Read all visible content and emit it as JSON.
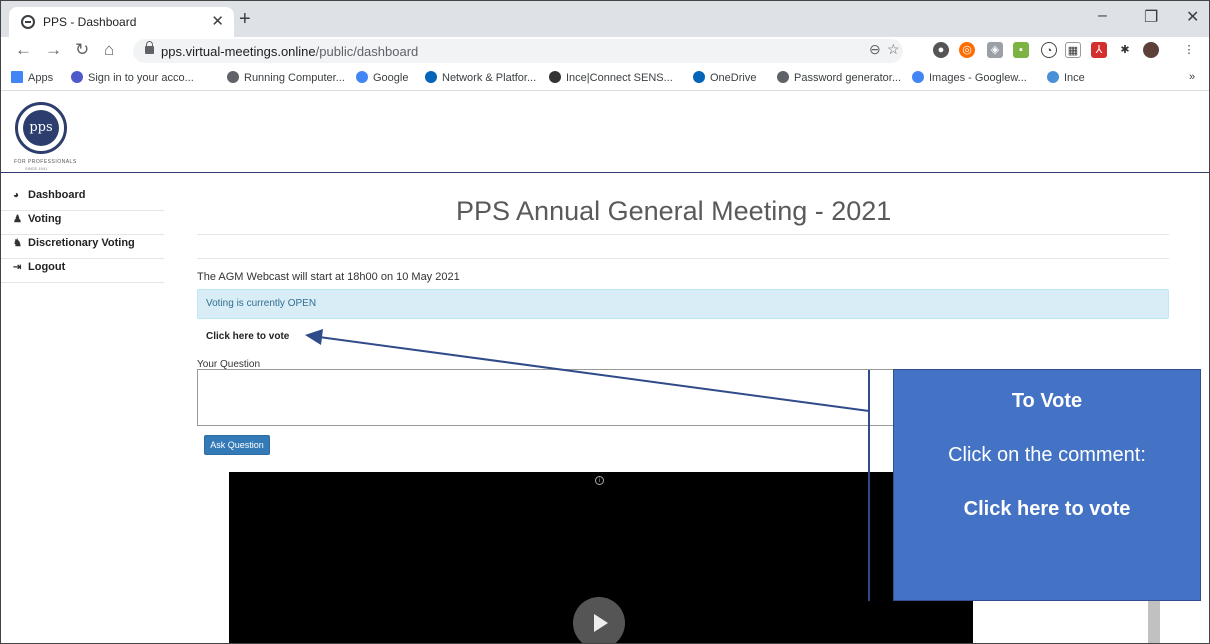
{
  "browser": {
    "tab_title": "PPS - Dashboard",
    "url_host": "pps.virtual-meetings.online",
    "url_path": "/public/dashboard",
    "bookmarks": [
      {
        "label": "Apps",
        "icon": "apps-grid-icon",
        "color": "#4285f4"
      },
      {
        "label": "Sign in to your acco...",
        "icon": "teams-icon",
        "color": "#5059c9"
      },
      {
        "label": "Running Computer...",
        "icon": "globe-icon",
        "color": "#5f6368"
      },
      {
        "label": "Google",
        "icon": "google-icon",
        "color": "#4285f4"
      },
      {
        "label": "Network & Platfor...",
        "icon": "onedrive-icon",
        "color": "#0364b8"
      },
      {
        "label": "Ince|Connect SENS...",
        "icon": "runner-icon",
        "color": "#333333"
      },
      {
        "label": "OneDrive",
        "icon": "onedrive-icon",
        "color": "#0364b8"
      },
      {
        "label": "Password generator...",
        "icon": "globe-icon",
        "color": "#5f6368"
      },
      {
        "label": "Images - Googlew...",
        "icon": "google-icon",
        "color": "#4285f4"
      },
      {
        "label": "Ince",
        "icon": "check-icon",
        "color": "#4a90d9"
      }
    ],
    "bookmarks_more": "»"
  },
  "site": {
    "logo_text": "pps",
    "logo_tagline": "FOR PROFESSIONALS",
    "logo_since": "SINCE 1941"
  },
  "sidebar": {
    "items": [
      {
        "label": "Dashboard",
        "icon": "dashboard-icon"
      },
      {
        "label": "Voting",
        "icon": "user-icon"
      },
      {
        "label": "Discretionary Voting",
        "icon": "users-icon"
      },
      {
        "label": "Logout",
        "icon": "logout-icon"
      }
    ]
  },
  "main": {
    "title": "PPS Annual General Meeting - 2021",
    "webcast_notice": "The AGM Webcast will start at 18h00 on 10 May 2021",
    "voting_status": "Voting is currently OPEN",
    "vote_link": "Click here to vote",
    "question_label": "Your Question",
    "ask_button": "Ask Question"
  },
  "callout": {
    "heading": "To Vote",
    "line": "Click on the comment:",
    "emphasis": "Click here to vote",
    "color": "#4472c4",
    "arrow_color": "#2f4b8a"
  }
}
